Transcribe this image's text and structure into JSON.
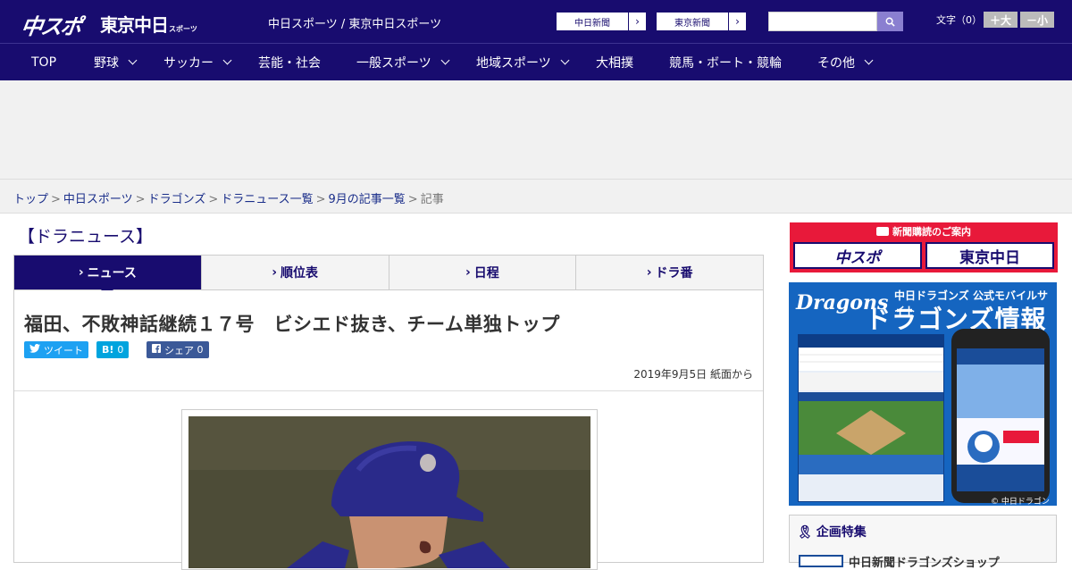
{
  "header": {
    "logo_chuspo": "中スポ",
    "logo_tokyo": "東京中日",
    "logo_tokyo_suffix": "スポーツ",
    "site_names": "中日スポーツ / 東京中日スポーツ",
    "ext_links": [
      {
        "label": "中日新聞"
      },
      {
        "label": "東京新聞"
      }
    ],
    "search": {
      "placeholder": ""
    },
    "font_label": "文字（0）",
    "font_bigger": "＋大",
    "font_smaller": "－小"
  },
  "nav": {
    "items": [
      {
        "label": "TOP",
        "has_menu": false
      },
      {
        "label": "野球",
        "has_menu": true
      },
      {
        "label": "サッカー",
        "has_menu": true
      },
      {
        "label": "芸能・社会",
        "has_menu": false
      },
      {
        "label": "一般スポーツ",
        "has_menu": true
      },
      {
        "label": "地域スポーツ",
        "has_menu": true
      },
      {
        "label": "大相撲",
        "has_menu": false
      },
      {
        "label": "競馬・ボート・競輪",
        "has_menu": false
      },
      {
        "label": "その他",
        "has_menu": true
      }
    ]
  },
  "breadcrumb": {
    "items": [
      "トップ",
      "中日スポーツ",
      "ドラゴンズ",
      "ドラニュース一覧",
      "9月の記事一覧"
    ],
    "current": "記事"
  },
  "section": {
    "heading": "【ドラニュース】"
  },
  "tabs": [
    {
      "label": "ニュース",
      "active": true
    },
    {
      "label": "順位表",
      "active": false
    },
    {
      "label": "日程",
      "active": false
    },
    {
      "label": "ドラ番",
      "active": false
    }
  ],
  "article": {
    "headline": "福田、不敗神話継続１７号　ビシエド抜き、チーム単独トップ",
    "share": {
      "tweet": "ツイート",
      "hatena_count": "0",
      "facebook_label": "シェア",
      "facebook_count": "0"
    },
    "date": "2019年9月5日 紙面から"
  },
  "sidebar": {
    "subscribe_title": "新聞購読のご案内",
    "subscribe_logos": [
      "中スポ",
      "東京中日"
    ],
    "dragons": {
      "logo": "Dragons",
      "small_text": "中日ドラゴンズ 公式モバイルサイト",
      "big_text": "ドラゴンズ情報",
      "footer": "© 中日ドラゴンズ"
    },
    "kikaku": {
      "title": "企画特集",
      "item": "中日新聞ドラゴンズショップ"
    }
  },
  "colors": {
    "brand_navy": "#180c6f",
    "subscribe_red": "#e8193a",
    "dragons_blue": "#1565c0",
    "twitter": "#1da1f2",
    "hatena": "#00a4de",
    "facebook": "#3b5998"
  }
}
